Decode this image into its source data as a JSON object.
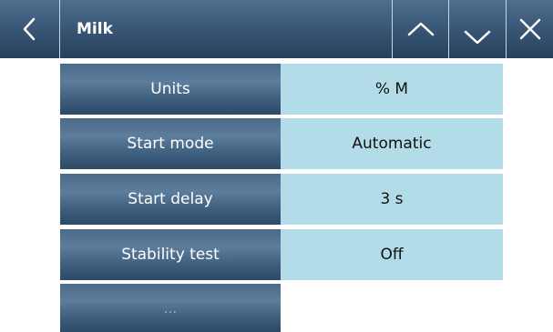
{
  "header": {
    "title": "Milk",
    "back_icon": "chevron-left-icon",
    "up_icon": "chevron-up-icon",
    "down_icon": "chevron-down-icon",
    "close_icon": "close-icon"
  },
  "settings": [
    {
      "label": "Units",
      "value": "% M"
    },
    {
      "label": "Start mode",
      "value": "Automatic"
    },
    {
      "label": "Start delay",
      "value": "3 s"
    },
    {
      "label": "Stability test",
      "value": "Off"
    }
  ],
  "more": {
    "label": "..."
  },
  "colors": {
    "header": "#3a5877",
    "label_bg": "#4a6a8a",
    "value_bg": "#b2dce8"
  }
}
